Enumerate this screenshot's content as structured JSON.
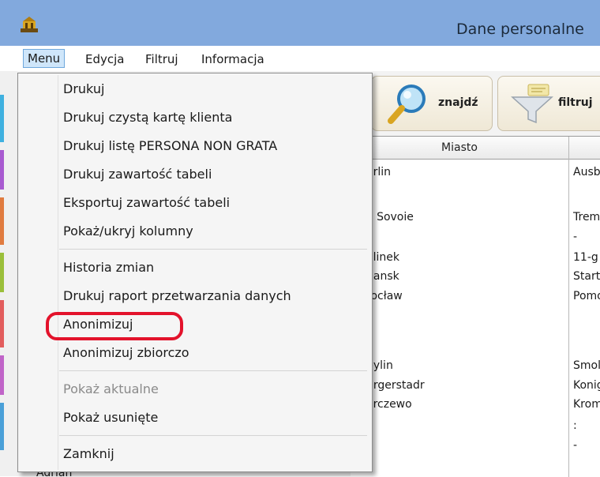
{
  "window": {
    "title": "Dane personalne"
  },
  "menubar": {
    "items": [
      {
        "label": "Menu"
      },
      {
        "label": "Edycja"
      },
      {
        "label": "Filtruj"
      },
      {
        "label": "Informacja"
      }
    ]
  },
  "toolbar": {
    "find_label": "znajdź",
    "filter_label": "filtruj"
  },
  "table": {
    "columns": [
      "Miasto",
      ""
    ],
    "rows": [
      {
        "city": "erlin",
        "street": "Ausb"
      },
      {
        "city": "",
        "street": ""
      },
      {
        "city": "e Sovoie",
        "street": "Trem"
      },
      {
        "city": "",
        "street": "-"
      },
      {
        "city": "alinek",
        "street": "11-g"
      },
      {
        "city": "dansk",
        "street": "Start"
      },
      {
        "city": "rocław",
        "street": "Pomo"
      },
      {
        "city": "",
        "street": ""
      },
      {
        "city": "",
        "street": ""
      },
      {
        "city": "bylin",
        "street": "Smol"
      },
      {
        "city": "urgerstadr",
        "street": "Konig"
      },
      {
        "city": "arczewo",
        "street": "Krom"
      },
      {
        "city": "",
        "street": ":"
      },
      {
        "city": "",
        "street": "-"
      }
    ],
    "bottom_peek": "Adrian"
  },
  "dropdown": {
    "items": [
      {
        "label": "Drukuj"
      },
      {
        "label": "Drukuj czystą kartę klienta"
      },
      {
        "label": "Drukuj listę PERSONA NON GRATA"
      },
      {
        "label": "Drukuj zawartość tabeli"
      },
      {
        "label": "Eksportuj zawartość tabeli"
      },
      {
        "label": "Pokaż/ukryj kolumny"
      },
      {
        "label": "Historia zmian"
      },
      {
        "label": "Drukuj raport przetwarzania danych"
      },
      {
        "label": "Anonimizuj"
      },
      {
        "label": "Anonimizuj zbiorczo"
      },
      {
        "label": "Pokaż aktualne"
      },
      {
        "label": "Pokaż usunięte"
      },
      {
        "label": "Zamknij"
      }
    ]
  },
  "colors": {
    "titlebar": "#82a9dd",
    "highlight": "#e3122b"
  }
}
